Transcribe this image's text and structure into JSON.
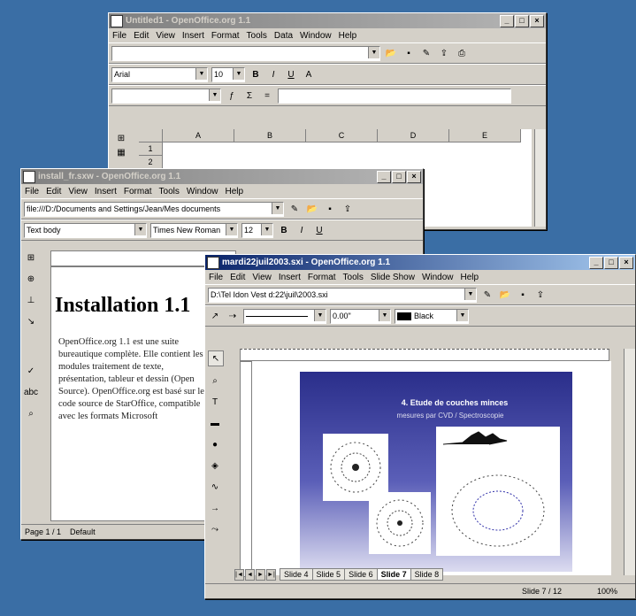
{
  "calc": {
    "title": "Untitled1 - OpenOffice.org 1.1",
    "menu": [
      "File",
      "Edit",
      "View",
      "Insert",
      "Format",
      "Tools",
      "Data",
      "Window",
      "Help"
    ],
    "font_name": "Arial",
    "font_size": "10",
    "bold": "B",
    "italic": "I",
    "underline": "U",
    "columns": [
      "A",
      "B",
      "C",
      "D",
      "E"
    ],
    "rows": [
      "1",
      "2"
    ]
  },
  "writer": {
    "title": "install_fr.sxw - OpenOffice.org 1.1",
    "menu": [
      "File",
      "Edit",
      "View",
      "Insert",
      "Format",
      "Tools",
      "Window",
      "Help"
    ],
    "path": "file:///D:/Documents and Settings/Jean/Mes documents",
    "style": "Text body",
    "font_name": "Times New Roman",
    "font_size": "12",
    "heading": "Installation 1.1",
    "body": "OpenOffice.org 1.1 est une suite bureautique complète. Elle contient les modules traitement de texte, présentation, tableur et dessin (Open Source). OpenOffice.org est basé sur le code source de StarOffice, compatible avec les formats Microsoft",
    "status_page": "Page 1 / 1",
    "status_style": "Default"
  },
  "impress": {
    "title": "mardi22juil2003.sxi - OpenOffice.org 1.1",
    "menu": [
      "File",
      "Edit",
      "View",
      "Insert",
      "Format",
      "Tools",
      "Slide Show",
      "Window",
      "Help"
    ],
    "path": "D:\\Tel Idon Vest d:22\\juil\\2003.sxi",
    "line_width": "0.00\"",
    "color_name": "Black",
    "slide_title": "4. Etude de couches minces",
    "slide_subtitle": "mesures par CVD / Spectroscopie",
    "tabs": [
      "Slide 4",
      "Slide 5",
      "Slide 6",
      "Slide 7",
      "Slide 8"
    ],
    "selected_tab": "Slide 7",
    "status_slide": "Slide 7 / 12",
    "status_zoom": "100%"
  },
  "colors": {
    "desktop": "#3a6ea5",
    "active_title": "#0a246a",
    "face": "#d4d0c8",
    "slide_top": "#2a2e8a",
    "slide_bottom": "#ffffff"
  }
}
